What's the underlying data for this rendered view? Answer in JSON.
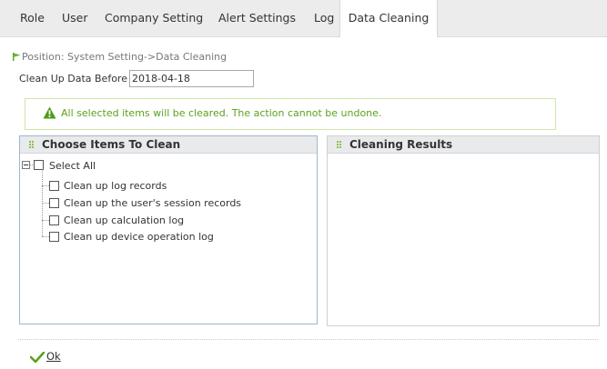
{
  "tabs": [
    "Role",
    "User",
    "Company Setting",
    "Alert Settings",
    "Log",
    "Data Cleaning"
  ],
  "active_tab": "Data Cleaning",
  "position": {
    "text": "Position: System Setting->Data Cleaning"
  },
  "form": {
    "date_label": "Clean Up Data Before",
    "date_value": "2018-04-18"
  },
  "warning": {
    "text": "All selected items will be cleared. The action cannot be undone."
  },
  "left_panel": {
    "title": "Choose Items To Clean",
    "select_all": "Select All",
    "items": [
      "Clean up log records",
      "Clean up the user's session records",
      "Clean up calculation log",
      "Clean up device operation log"
    ]
  },
  "right_panel": {
    "title": "Cleaning Results"
  },
  "ok_button": {
    "label": "Ok"
  },
  "colors": {
    "accent_green": "#5aa21d",
    "tab_bar": "#ececec",
    "panel_border": "#9fb7cd"
  },
  "icons": [
    "flag-icon",
    "warning-icon",
    "grip-icon",
    "collapse-icon",
    "check-icon"
  ]
}
